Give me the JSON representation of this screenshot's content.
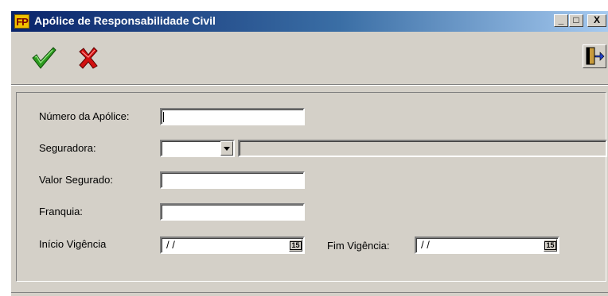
{
  "window": {
    "title": "Apólice de Responsabilidade Civil",
    "app_icon_text": "FP",
    "minimize_label": "_",
    "maximize_label": "□",
    "close_label": "X"
  },
  "toolbar": {
    "confirm_icon": "green-checkmark-icon",
    "cancel_icon": "red-x-icon",
    "exit_icon": "exit-door-icon"
  },
  "form": {
    "numero_label": "Número da Apólice:",
    "numero_value": "",
    "seguradora_label": "Seguradora:",
    "seguradora_value": "",
    "seguradora_name": "",
    "valor_label": "Valor Segurado:",
    "valor_value": "",
    "franquia_label": "Franquia:",
    "franquia_value": "",
    "inicio_label": "Início Vigência",
    "inicio_value": "/ /",
    "fim_label": "Fim Vigência:",
    "fim_value": "/ /",
    "calendar_text": "15"
  },
  "colors": {
    "titlebar_start": "#0a246a",
    "titlebar_end": "#a6caf0",
    "window_face": "#d4d0c8"
  }
}
